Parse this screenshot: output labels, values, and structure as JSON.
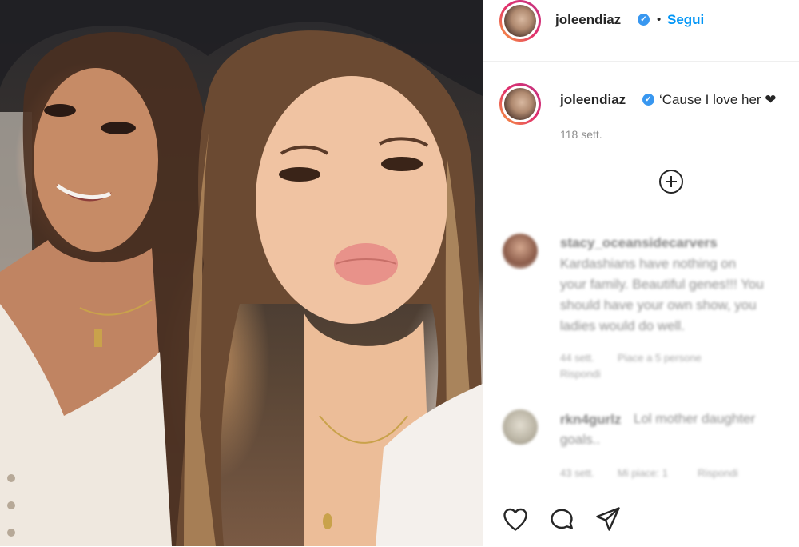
{
  "post": {
    "username": "joleendiaz",
    "separator": "•",
    "follow_label": "Segui",
    "caption": "‘Cause I love her ❤",
    "caption_time": "118 sett.",
    "more_comments_icon": "plus-circle-icon"
  },
  "comments": [
    {
      "user": "stacy_oceansidecarvers",
      "lines": [
        "Kardashians have nothing on",
        "your family. Beautiful genes!!! You",
        "should have your own show, you",
        "ladies would do well."
      ],
      "time": "44 sett.",
      "likes": "Piace a 5 persone",
      "reply": "Rispondi"
    },
    {
      "user": "rkn4gurlz",
      "text_inline": "Lol mother daughter",
      "text_line2": "goals..",
      "time": "43 sett.",
      "likes": "Mi piace: 1",
      "reply": "Rispondi"
    }
  ],
  "actions": {
    "like_icon": "heart-icon",
    "comment_icon": "comment-icon",
    "share_icon": "paper-plane-icon"
  },
  "colors": {
    "accent": "#0095f6",
    "verified": "#3897f0",
    "text": "#262626",
    "muted": "#8e8e8e"
  }
}
